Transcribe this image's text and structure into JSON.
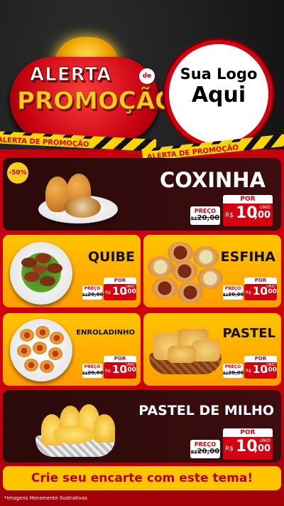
{
  "header": {
    "badge_line1": "ALERTA",
    "badge_de": "de",
    "badge_line2": "PROMOÇÃO",
    "logo_line1": "Sua Logo",
    "logo_line2": "Aqui"
  },
  "tape_text": "ALERTA DE PROMOÇÃO",
  "discount_badge": "-50%",
  "products": [
    {
      "name": "COXINHA",
      "por": "POR",
      "preco_label": "PREÇO",
      "old_prefix": "R$",
      "old_price": "20,00",
      "currency": "R$",
      "price_int": "10",
      "price_dec": ",00",
      "unid": "UNID"
    },
    {
      "name": "QUIBE",
      "por": "POR",
      "preco_label": "PREÇO",
      "old_prefix": "R$",
      "old_price": "20,00",
      "currency": "R$",
      "price_int": "10",
      "price_dec": ",00",
      "unid": "UNID"
    },
    {
      "name": "ESFIHA",
      "por": "POR",
      "preco_label": "PREÇO",
      "old_prefix": "R$",
      "old_price": "20,00",
      "currency": "R$",
      "price_int": "10",
      "price_dec": ",00",
      "unid": "UNID"
    },
    {
      "name": "ENROLADINHO",
      "por": "POR",
      "preco_label": "PREÇO",
      "old_prefix": "R$",
      "old_price": "20,00",
      "currency": "R$",
      "price_int": "10",
      "price_dec": ",00",
      "unid": "UNID"
    },
    {
      "name": "PASTEL",
      "por": "POR",
      "preco_label": "PREÇO",
      "old_prefix": "R$",
      "old_price": "20,00",
      "currency": "R$",
      "price_int": "10",
      "price_dec": ",00",
      "unid": "UNID"
    },
    {
      "name": "PASTEL DE MILHO",
      "por": "POR",
      "preco_label": "PREÇO",
      "old_prefix": "R$",
      "old_price": "20,00",
      "currency": "R$",
      "price_int": "10",
      "price_dec": ",00",
      "unid": "UNID"
    }
  ],
  "cta": "Crie seu encarte com este tema!",
  "footnote": "*Imagens Meramente Ilustrativas",
  "colors": {
    "red": "#d3000f",
    "yellow": "#ffc400",
    "dark": "#2a0a0a"
  }
}
